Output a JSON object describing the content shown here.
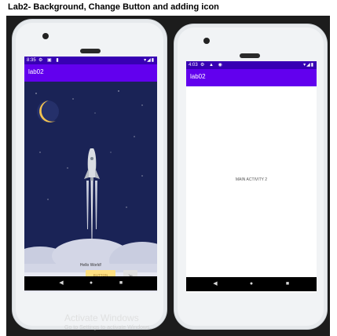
{
  "heading": "Lab2- Background, Change Button and adding icon",
  "colors": {
    "appbar": "#6200ee",
    "night_sky": "#1a2356",
    "button": "#ffe082"
  },
  "phone_left": {
    "status": {
      "time": "8:35",
      "left_icons": "⚙ ▣ ▮",
      "right_icons": "▾◢▮"
    },
    "app_title": "lab02",
    "hello_text": "Hello World!",
    "button_label": "BUTTON",
    "send_icon": "send-icon",
    "nav": {
      "back": "◀",
      "home": "●",
      "recents": "■"
    }
  },
  "phone_right": {
    "status": {
      "time": "4:03",
      "left_icons": "⚙ ▲ ◉",
      "right_icons": "▾◢▮"
    },
    "app_title": "lab02",
    "main_text": "MAIN ACTIVITY 2",
    "nav": {
      "back": "◀",
      "home": "●",
      "recents": "■"
    }
  },
  "watermark": {
    "title": "Activate Windows",
    "subtitle": "Go to Settings to activate Windows."
  }
}
